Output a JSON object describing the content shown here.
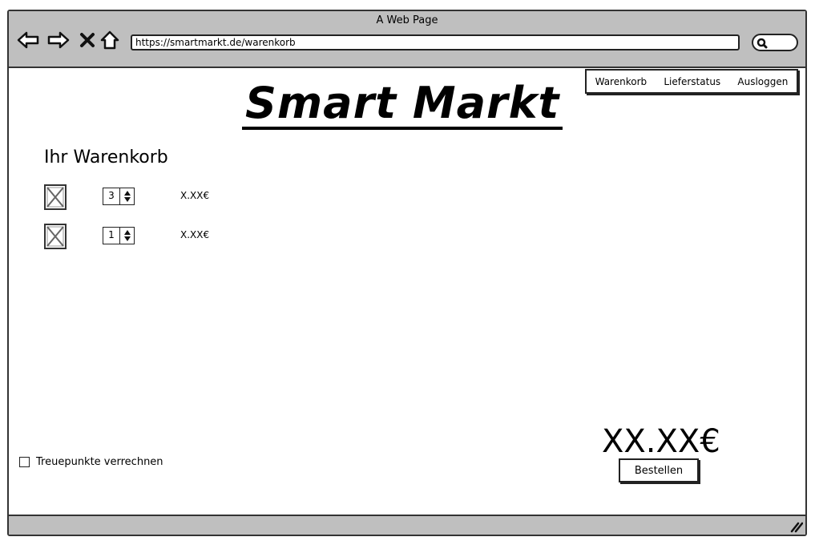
{
  "window": {
    "title": "A Web Page"
  },
  "browser": {
    "url": "https://smartmarkt.de/warenkorb"
  },
  "nav": {
    "items": [
      "Warenkorb",
      "Lieferstatus",
      "Ausloggen"
    ]
  },
  "logo": {
    "text": "Smart Markt"
  },
  "cart": {
    "heading": "Ihr Warenkorb",
    "items": [
      {
        "quantity": "3",
        "price": "X.XX€"
      },
      {
        "quantity": "1",
        "price": "X.XX€"
      }
    ]
  },
  "loyalty": {
    "label": "Treuepunkte verrechnen"
  },
  "checkout": {
    "total": "XX.XX€",
    "order_label": "Bestellen"
  },
  "icons": [
    "back-icon",
    "forward-icon",
    "close-icon",
    "home-icon",
    "search-icon",
    "placeholder-image-icon",
    "spinner-arrows-icon",
    "resize-grip-icon"
  ]
}
